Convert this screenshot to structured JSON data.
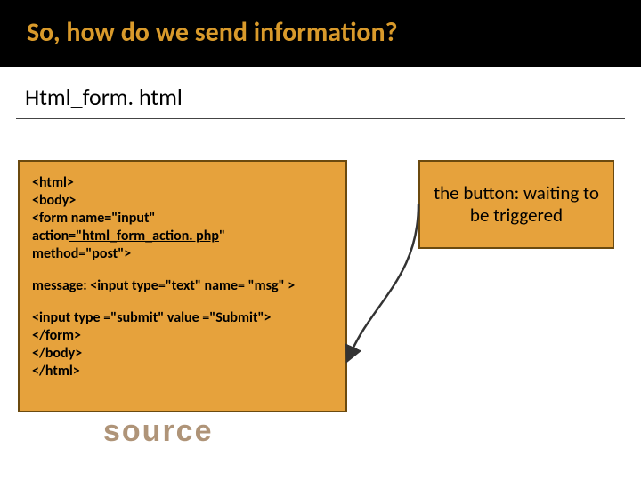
{
  "title": "So, how do we send information?",
  "subtitle": "Html_form. html",
  "code": {
    "l1": "<html>",
    "l2": "<body>",
    "l3": "<form name=\"input\"",
    "l4a": "action",
    "l4b": "=\"html_form_action. php",
    "l4c": "\"",
    "l5": "method=\"post\">",
    "l6": "message: <input type=\"text\" name= \"msg\" >",
    "l7": "<input type =\"submit\" value =\"Submit\">",
    "l8": "</form>",
    "l9": "</body>",
    "l10": "</html>"
  },
  "callout": "the button: waiting to be triggered",
  "sourceLabel": "source"
}
